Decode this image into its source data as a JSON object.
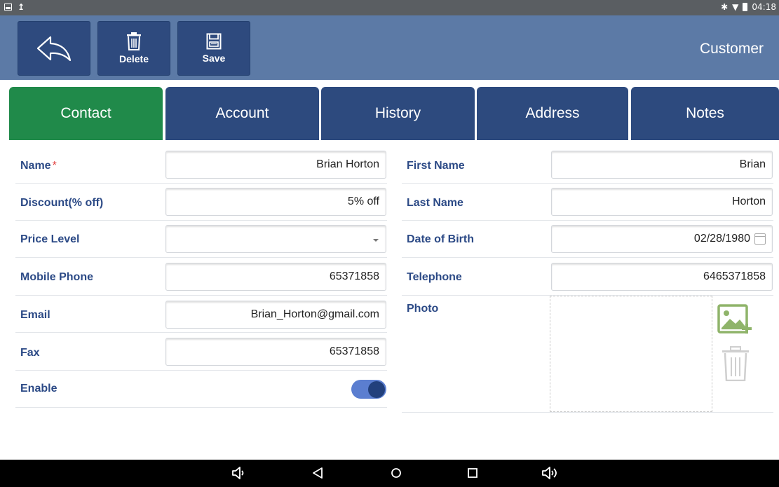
{
  "status_bar": {
    "time": "04:18",
    "bluetooth_icon": "bluetooth-icon",
    "wifi_icon": "wifi-icon",
    "battery_icon": "battery-icon"
  },
  "toolbar": {
    "back_icon": "back-arrow-icon",
    "delete_label": "Delete",
    "save_label": "Save",
    "title": "Customer"
  },
  "tabs": [
    {
      "label": "Contact",
      "active": true
    },
    {
      "label": "Account",
      "active": false
    },
    {
      "label": "History",
      "active": false
    },
    {
      "label": "Address",
      "active": false
    },
    {
      "label": "Notes",
      "active": false
    }
  ],
  "form": {
    "name": {
      "label": "Name",
      "required_mark": "*",
      "value": "Brian Horton"
    },
    "discount": {
      "label": "Discount(% off)",
      "value": "5% off"
    },
    "price_level": {
      "label": "Price Level",
      "value": ""
    },
    "mobile_phone": {
      "label": "Mobile Phone",
      "value": "65371858"
    },
    "email": {
      "label": "Email",
      "value": "Brian_Horton@gmail.com"
    },
    "fax": {
      "label": "Fax",
      "value": "65371858"
    },
    "enable": {
      "label": "Enable",
      "on": true
    },
    "first_name": {
      "label": "First Name",
      "value": "Brian"
    },
    "last_name": {
      "label": "Last Name",
      "value": "Horton"
    },
    "date_of_birth": {
      "label": "Date of Birth",
      "value": "02/28/1980"
    },
    "telephone": {
      "label": "Telephone",
      "value": "6465371858"
    },
    "photo": {
      "label": "Photo"
    }
  },
  "colors": {
    "header": "#5c7aa6",
    "button": "#2e4a7e",
    "tab": "#2d4a7e",
    "tab_active": "#208a4a",
    "label": "#2c4a86",
    "required": "#e03a3a",
    "toggle_track": "#5b7ed0",
    "toggle_knob": "#22407c"
  },
  "nav_bar": {
    "icons": [
      "volume-down-icon",
      "back-triangle-icon",
      "home-circle-icon",
      "recents-square-icon",
      "volume-up-icon"
    ]
  }
}
